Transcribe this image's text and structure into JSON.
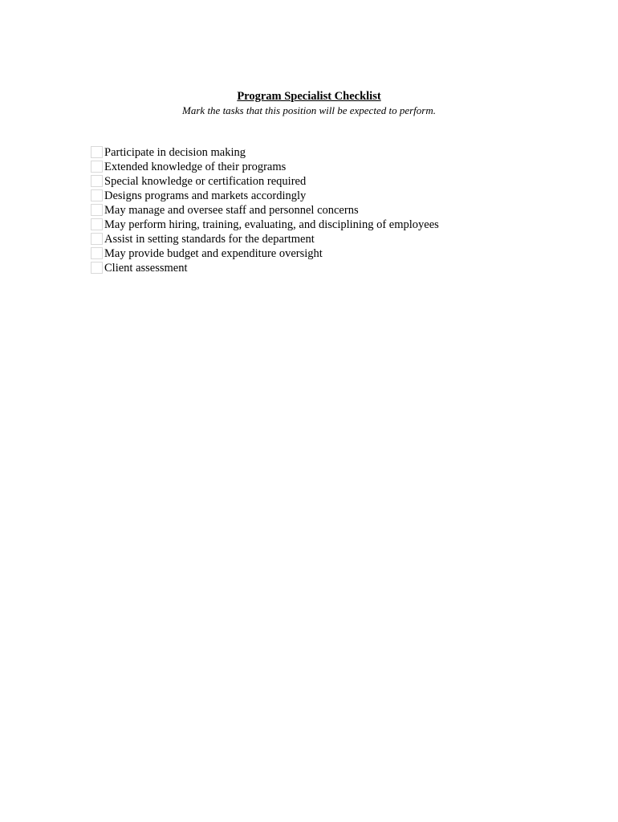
{
  "document": {
    "title": "Program Specialist Checklist",
    "subtitle": "Mark the tasks that this position will be expected to perform.",
    "checklist": [
      {
        "label": "Participate in decision making",
        "checked": false
      },
      {
        "label": "Extended knowledge of their programs",
        "checked": false
      },
      {
        "label": "Special knowledge or certification required",
        "checked": false
      },
      {
        "label": "Designs programs and markets accordingly",
        "checked": false
      },
      {
        "label": "May manage and oversee staff and personnel concerns",
        "checked": false
      },
      {
        "label": "May perform hiring, training, evaluating, and disciplining of employees",
        "checked": false
      },
      {
        "label": "Assist in setting standards for the department",
        "checked": false
      },
      {
        "label": "May provide budget and expenditure oversight",
        "checked": false
      },
      {
        "label": "Client assessment",
        "checked": false
      }
    ]
  }
}
